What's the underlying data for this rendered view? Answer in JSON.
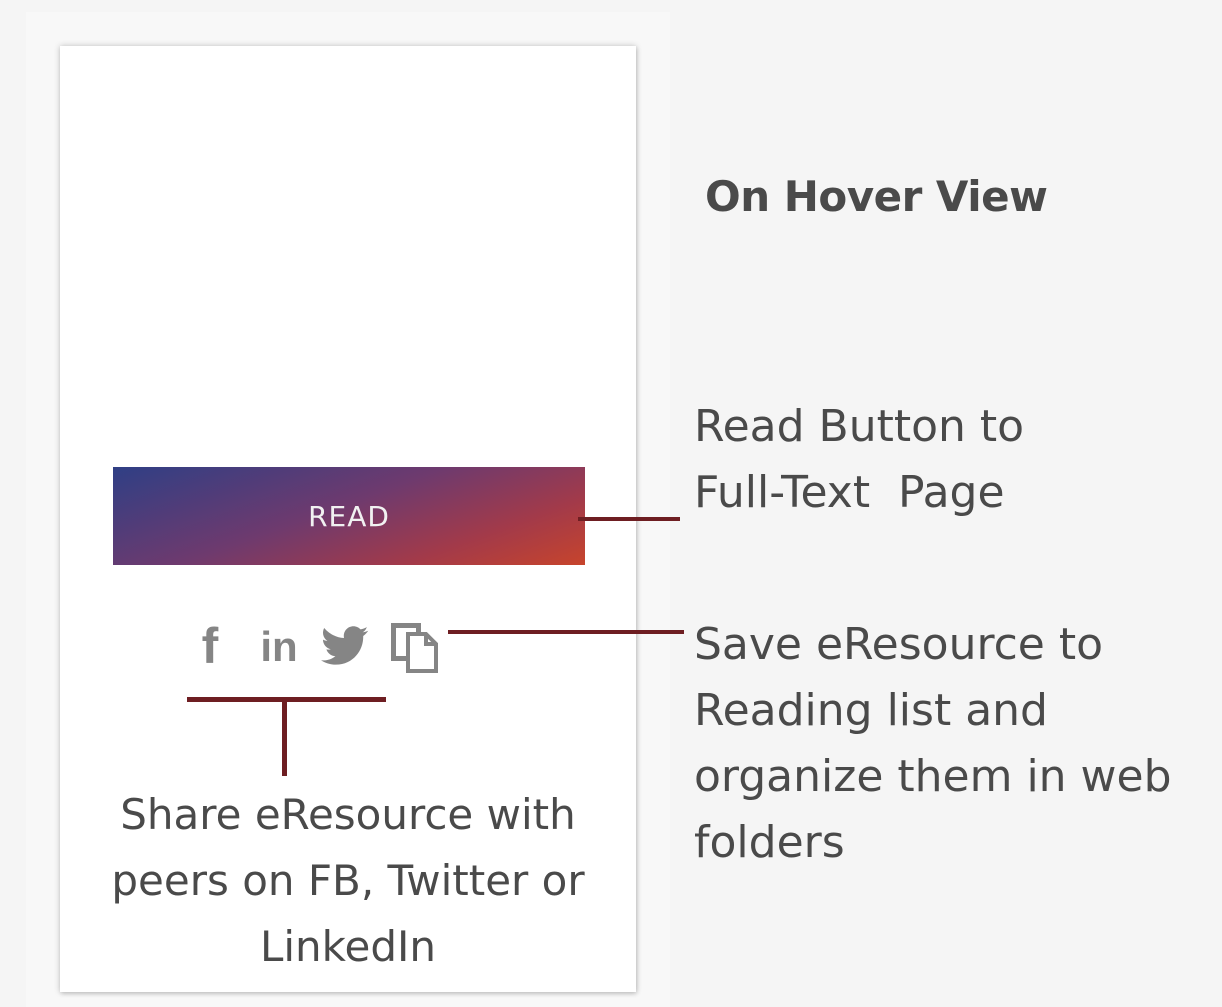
{
  "heading": "On Hover View",
  "card": {
    "read_button": "READ",
    "icons": [
      "facebook-icon",
      "linkedin-icon",
      "twitter-icon",
      "save-to-list-icon"
    ],
    "facebook_glyph": "f",
    "linkedin_glyph": "in"
  },
  "annotations": {
    "read": {
      "line1": "Read Button to",
      "line2": "Full-Text  Page"
    },
    "save": {
      "line1": "Save eResource to",
      "line2": "Reading list and",
      "line3": "organize them in web",
      "line4": "folders"
    },
    "share": {
      "line1": "Share eResource with",
      "line2": "peers on FB, Twitter or",
      "line3": "LinkedIn"
    }
  },
  "colors": {
    "connector": "#6e1e22",
    "text": "#4a4a4a",
    "icon": "#858585",
    "button_gradient_start": "#2f3f85",
    "button_gradient_end": "#c7442c"
  }
}
